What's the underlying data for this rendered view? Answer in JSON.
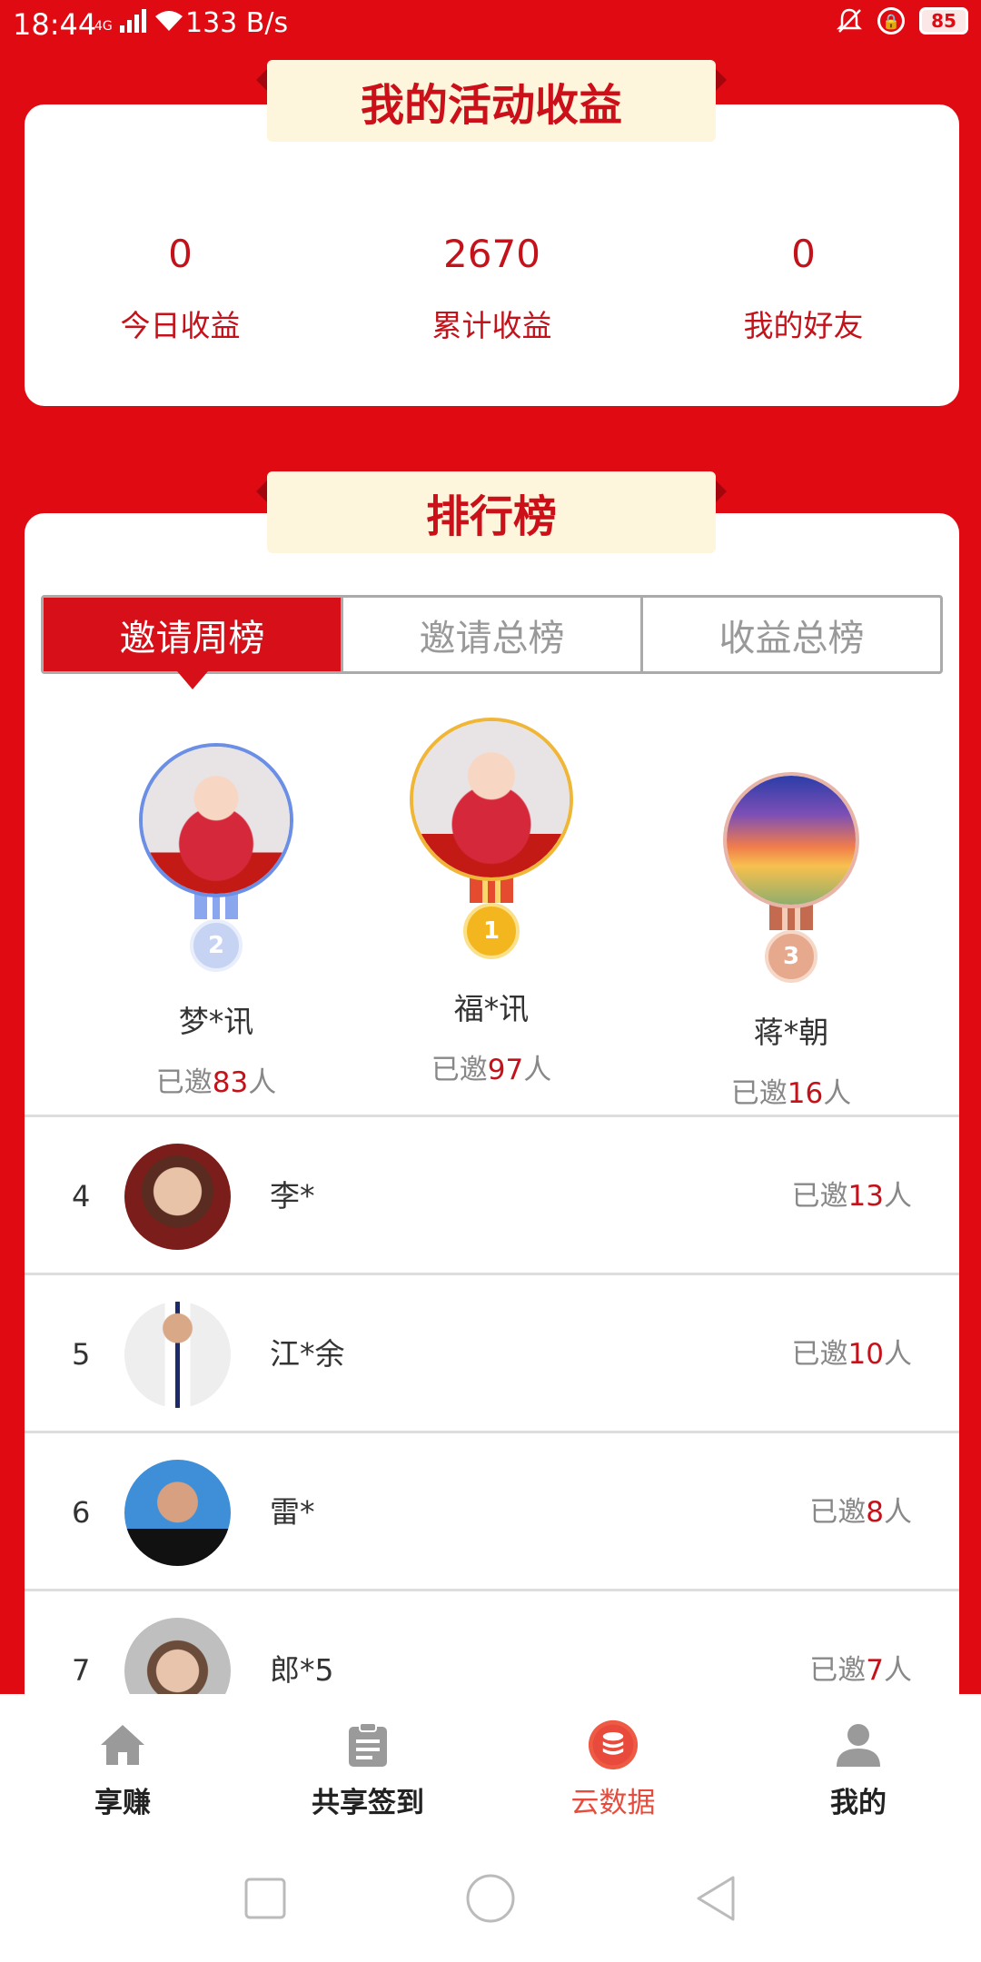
{
  "status_bar": {
    "time": "18:44",
    "network": "4G",
    "speed": "133 B/s",
    "battery": "85"
  },
  "earnings": {
    "title": "我的活动收益",
    "stats": [
      {
        "value": "0",
        "label": "今日收益"
      },
      {
        "value": "2670",
        "label": "累计收益"
      },
      {
        "value": "0",
        "label": "我的好友"
      }
    ]
  },
  "leaderboard": {
    "title": "排行榜",
    "tabs": [
      "邀请周榜",
      "邀请总榜",
      "收益总榜"
    ],
    "active_tab": 0,
    "invite_prefix": "已邀",
    "invite_suffix": "人",
    "podium": [
      {
        "rank": "2",
        "name": "梦*讯",
        "count": "83"
      },
      {
        "rank": "1",
        "name": "福*讯",
        "count": "97"
      },
      {
        "rank": "3",
        "name": "蒋*朝",
        "count": "16"
      }
    ],
    "rows": [
      {
        "rank": "4",
        "name": "李*",
        "count": "13"
      },
      {
        "rank": "5",
        "name": "江*余",
        "count": "10"
      },
      {
        "rank": "6",
        "name": "雷*",
        "count": "8"
      },
      {
        "rank": "7",
        "name": "郎*5",
        "count": "7"
      }
    ]
  },
  "bottom_nav": {
    "items": [
      {
        "label": "享赚",
        "icon": "home-icon"
      },
      {
        "label": "共享签到",
        "icon": "clipboard-icon"
      },
      {
        "label": "云数据",
        "icon": "database-icon"
      },
      {
        "label": "我的",
        "icon": "user-icon"
      }
    ],
    "active": 2
  },
  "colors": {
    "brand_red": "#e00a12",
    "title_bg": "#fdf6dc",
    "active_nav": "#e84b3c"
  }
}
